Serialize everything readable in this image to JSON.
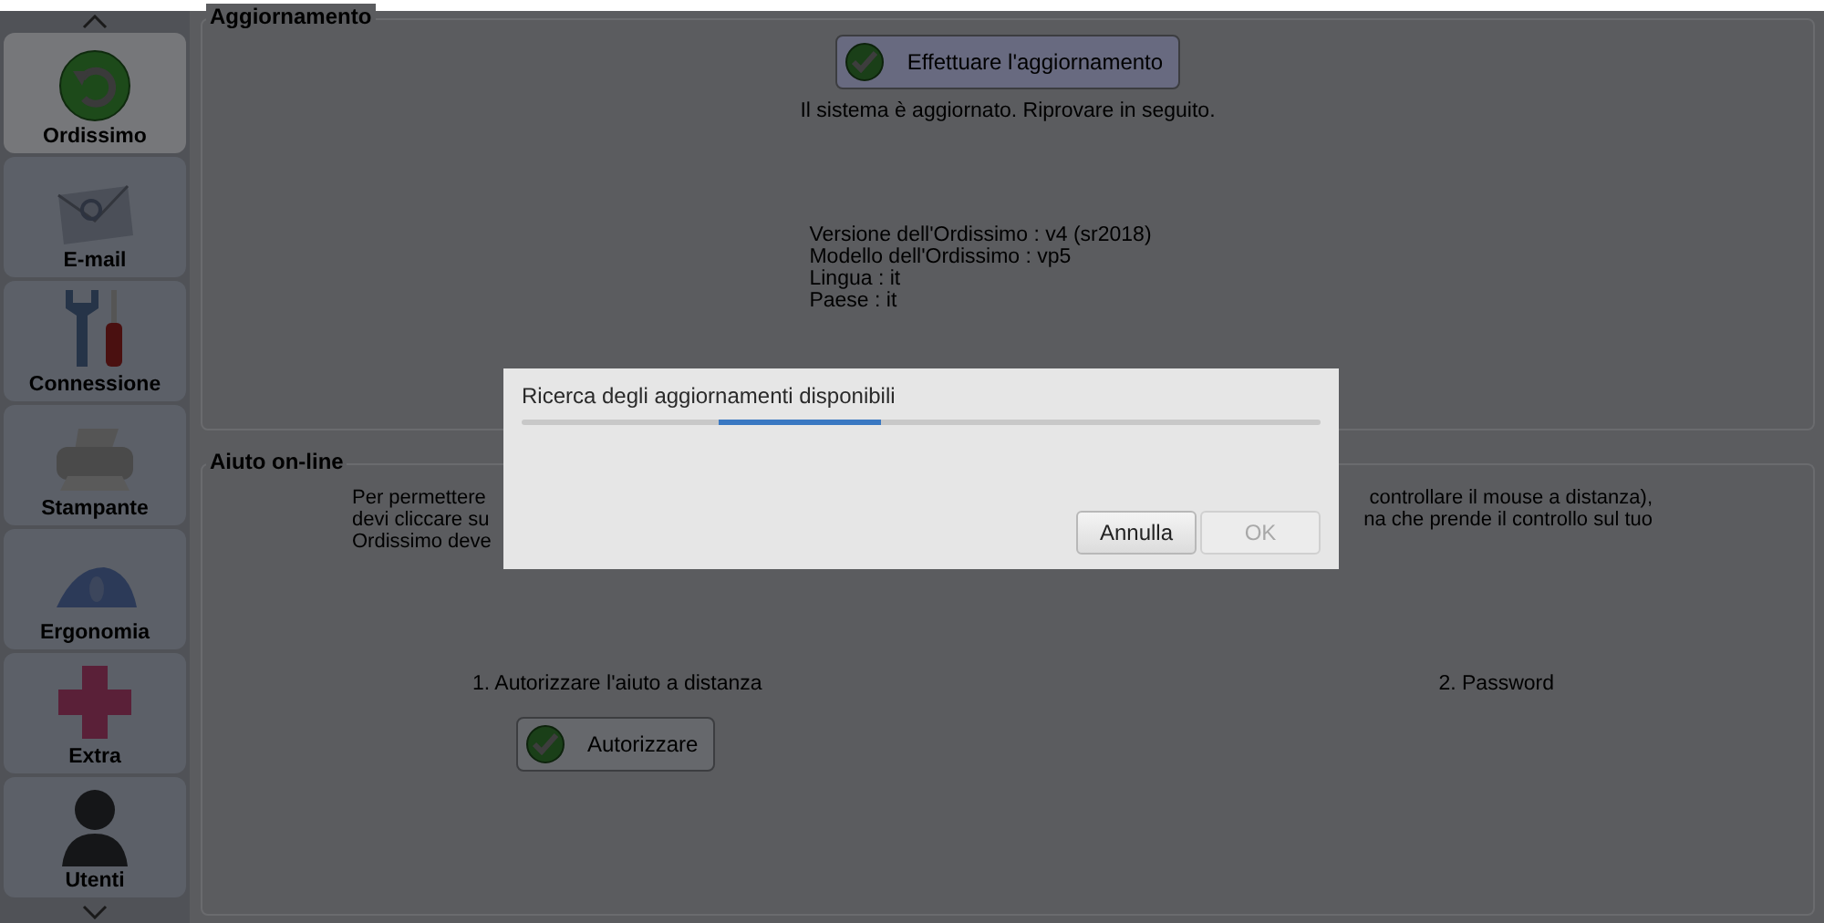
{
  "sidebar": {
    "items": [
      {
        "label": "Ordissimo",
        "kind": "refresh",
        "selected": true
      },
      {
        "label": "E-mail",
        "kind": "mail",
        "selected": false
      },
      {
        "label": "Connessione",
        "kind": "tools",
        "selected": false
      },
      {
        "label": "Stampante",
        "kind": "printer",
        "selected": false
      },
      {
        "label": "Ergonomia",
        "kind": "mouse",
        "selected": false
      },
      {
        "label": "Extra",
        "kind": "plus",
        "selected": false
      },
      {
        "label": "Utenti",
        "kind": "user",
        "selected": false
      }
    ]
  },
  "update_section": {
    "title": "Aggiornamento",
    "button": "Effettuare l'aggiornamento",
    "status": "Il sistema è aggiornato. Riprovare in seguito.",
    "info": [
      "Versione dell'Ordissimo : v4 (sr2018)",
      "Modello dell'Ordissimo : vp5",
      "Lingua : it",
      "Paese : it"
    ]
  },
  "help_section": {
    "title": "Aiuto on-line",
    "paragraph_left": [
      "Per permettere",
      "devi cliccare su",
      "Ordissimo deve"
    ],
    "paragraph_right": [
      "controllare il mouse a distanza),",
      "na che prende il controllo sul tuo"
    ],
    "step_1": "1. Autorizzare l'aiuto a distanza",
    "step_1_button": "Autorizzare",
    "step_2": "2. Password"
  },
  "dialog": {
    "message": "Ricerca degli aggiornamenti disponibili",
    "buttons": [
      {
        "label": "Annulla",
        "disabled": false
      },
      {
        "label": "OK",
        "disabled": true
      }
    ]
  }
}
